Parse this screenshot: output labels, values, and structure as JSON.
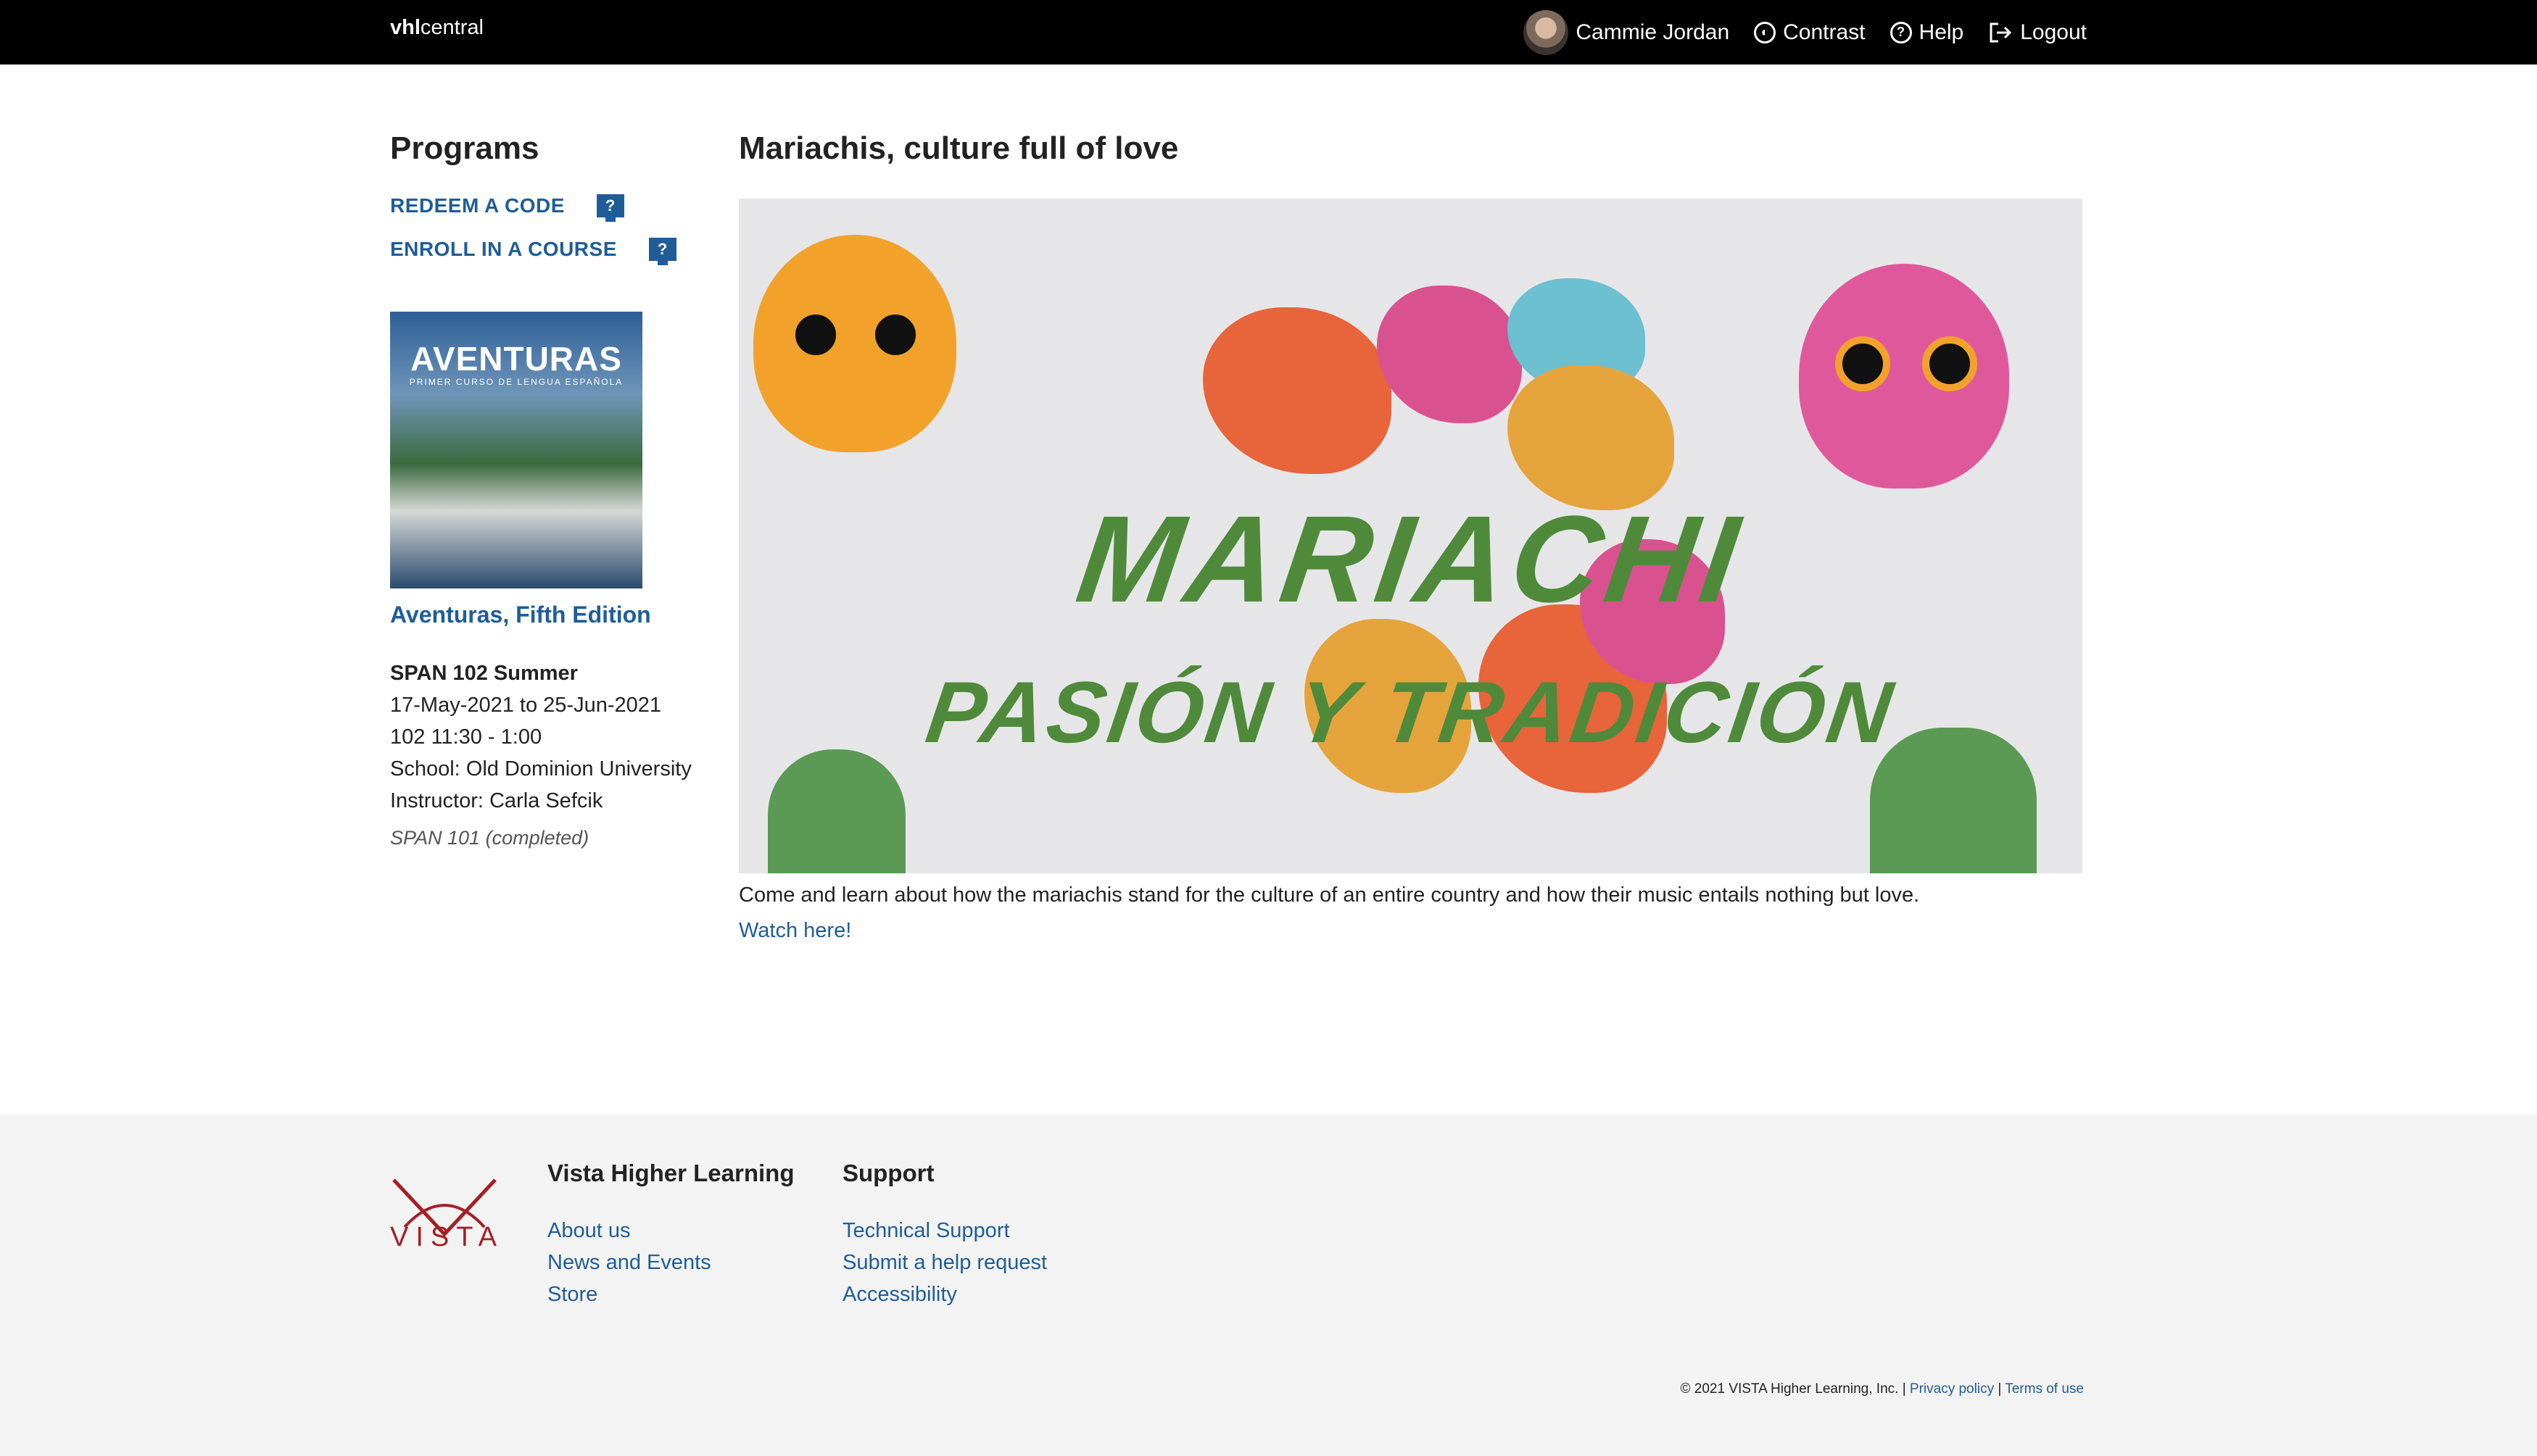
{
  "header": {
    "brand_bold": "vhl",
    "brand_rest": "central",
    "user_name": "Cammie Jordan",
    "contrast_label": "Contrast",
    "help_label": "Help",
    "logout_label": "Logout"
  },
  "sidebar": {
    "title": "Programs",
    "redeem_label": "REDEEM A CODE",
    "enroll_label": "ENROLL IN A COURSE",
    "cover_title": "AVENTURAS",
    "cover_subtitle": "PRIMER CURSO DE LENGUA ESPAÑOLA",
    "book_title": "Aventuras, Fifth Edition",
    "course_name": "SPAN 102 Summer",
    "course_dates": "17-May-2021 to 25-Jun-2021",
    "course_section": "102 11:30 - 1:00",
    "course_school": "School: Old Dominion University",
    "course_instructor": "Instructor: Carla Sefcik",
    "completed_course": "SPAN 101 (completed)"
  },
  "main": {
    "title": "Mariachis, culture full of love",
    "hero_line1": "MARIACHI",
    "hero_line2": "PASIÓN Y TRADICIÓN",
    "description": "Come and learn about how the mariachis stand for the culture of an entire country and how their music entails nothing but love.",
    "watch_link": "Watch here!"
  },
  "footer": {
    "logo_word": "VISTA",
    "col1_title": "Vista Higher Learning",
    "col1_links": [
      "About us",
      "News and Events",
      "Store"
    ],
    "col2_title": "Support",
    "col2_links": [
      "Technical Support",
      "Submit a help request",
      "Accessibility"
    ],
    "copyright": "© 2021 VISTA Higher Learning, Inc. |",
    "privacy": "Privacy policy",
    "separator": "|",
    "terms": "Terms of use"
  },
  "colors": {
    "link_blue": "#1f5d99",
    "vista_red": "#a42026",
    "hero_green": "#4e8a3a"
  },
  "icons": [
    "avatar",
    "contrast-icon",
    "help-icon",
    "logout-icon",
    "question-screen-icon",
    "vista-logo-icon"
  ]
}
